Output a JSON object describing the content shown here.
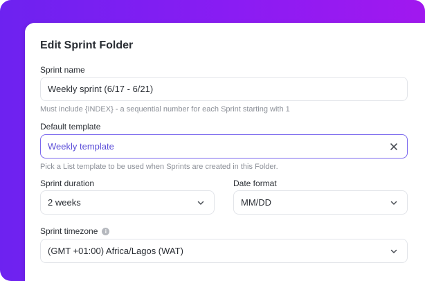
{
  "dialog": {
    "title": "Edit Sprint Folder"
  },
  "sprint_name": {
    "label": "Sprint name",
    "value": "Weekly sprint (6/17 - 6/21)",
    "helper": "Must include {INDEX} - a sequential number for each Sprint starting with 1"
  },
  "default_template": {
    "label": "Default template",
    "value": "Weekly template",
    "helper": "Pick a List template to be used when Sprints are created in this Folder.",
    "clear_icon": "close-icon"
  },
  "sprint_duration": {
    "label": "Sprint duration",
    "value": "2 weeks",
    "icon": "chevron-down-icon"
  },
  "date_format": {
    "label": "Date format",
    "value": "MM/DD",
    "icon": "chevron-down-icon"
  },
  "sprint_timezone": {
    "label": "Sprint timezone",
    "info_icon": "info-icon",
    "info_glyph": "i",
    "value": "(GMT +01:00) Africa/Lagos (WAT)",
    "icon": "chevron-down-icon"
  },
  "colors": {
    "accent": "#7b68ee",
    "background_gradient_start": "#6d22f0",
    "background_gradient_end": "#a118ef",
    "text": "#2a2e34",
    "helper_text": "#8b8f97"
  }
}
